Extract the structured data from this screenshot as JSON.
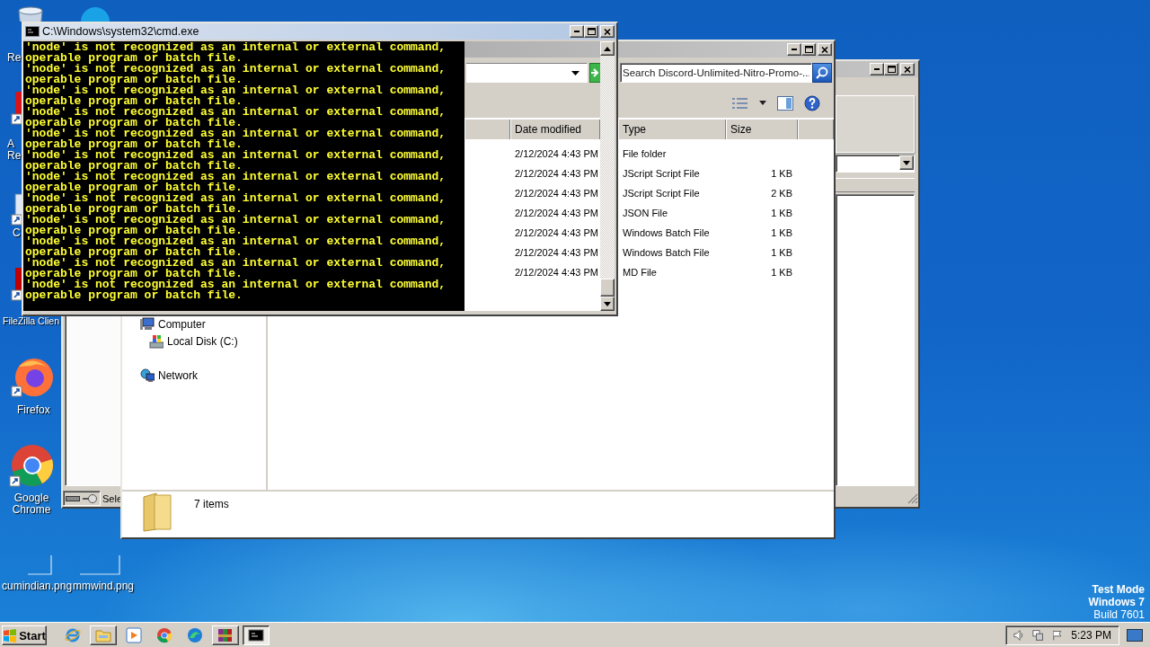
{
  "desktop": {
    "icons": [
      {
        "kind": "bin",
        "lines": [
          "Re"
        ]
      },
      {
        "kind": "blue_circle"
      },
      {
        "kind": "red_doc",
        "lines": [
          "A",
          "Re"
        ]
      },
      {
        "kind": "app",
        "lines": [
          "C"
        ]
      },
      {
        "kind": "red_app",
        "lines": [
          "FileZilla Clien"
        ]
      },
      {
        "kind": "fox_browser",
        "lines": [
          "Firefox"
        ]
      },
      {
        "kind": "round_browser",
        "lines": [
          "Google",
          "Chrome"
        ]
      },
      {
        "kind": "image",
        "lines": [
          "cumindian.png"
        ]
      },
      {
        "kind": "image",
        "lines": [
          "mmwind.png"
        ]
      }
    ],
    "system_info": [
      {
        "text": "Test Mode",
        "emphasis": true
      },
      {
        "text": "Windows 7",
        "emphasis": true
      },
      {
        "text": "Build 7601",
        "emphasis": false
      }
    ]
  },
  "background_window": {
    "status_text": "Sele"
  },
  "explorer_window": {
    "search": {
      "placeholder": "Search Discord-Unlimited-Nitro-Promo-..."
    },
    "nav": [
      {
        "kind": "computer",
        "label": "Computer",
        "children": [
          {
            "kind": "disk",
            "label": "Local Disk (C:)"
          }
        ]
      },
      {
        "kind": "network",
        "label": "Network"
      }
    ],
    "columns": [
      "Date modified",
      "Type",
      "Size"
    ],
    "rows": [
      {
        "date_modified": "2/12/2024 4:43 PM",
        "type": "File folder"
      },
      {
        "date_modified": "2/12/2024 4:43 PM",
        "type": "JScript Script File",
        "size": "1 KB"
      },
      {
        "date_modified": "2/12/2024 4:43 PM",
        "type": "JScript Script File",
        "size": "2 KB"
      },
      {
        "date_modified": "2/12/2024 4:43 PM",
        "type": "JSON File",
        "size": "1 KB"
      },
      {
        "date_modified": "2/12/2024 4:43 PM",
        "type": "Windows Batch File",
        "size": "1 KB"
      },
      {
        "date_modified": "2/12/2024 4:43 PM",
        "type": "Windows Batch File",
        "size": "1 KB"
      },
      {
        "date_modified": "2/12/2024 4:43 PM",
        "type": "MD File",
        "size": "1 KB"
      }
    ],
    "status": "7 items"
  },
  "console_window": {
    "title": "C:\\Windows\\system32\\cmd.exe",
    "lines": [
      "'node' is not recognized as an internal or external command,",
      "operable program or batch file.",
      "'node' is not recognized as an internal or external command,",
      "operable program or batch file.",
      "'node' is not recognized as an internal or external command,",
      "operable program or batch file.",
      "'node' is not recognized as an internal or external command,",
      "operable program or batch file.",
      "'node' is not recognized as an internal or external command,",
      "operable program or batch file.",
      "'node' is not recognized as an internal or external command,",
      "operable program or batch file.",
      "'node' is not recognized as an internal or external command,",
      "operable program or batch file.",
      "'node' is not recognized as an internal or external command,",
      "operable program or batch file.",
      "'node' is not recognized as an internal or external command,",
      "operable program or batch file.",
      "'node' is not recognized as an internal or external command,",
      "operable program or batch file.",
      "'node' is not recognized as an internal or external command,",
      "operable program or batch file.",
      "'node' is not recognized as an internal or external command,",
      "operable program or batch file."
    ]
  },
  "taskbar": {
    "start": "Start",
    "apps": [
      {
        "kind": "e_browser",
        "open": false,
        "selected": false
      },
      {
        "kind": "folder",
        "open": true,
        "selected": false
      },
      {
        "kind": "player",
        "open": false,
        "selected": false
      },
      {
        "kind": "round_browser",
        "open": false,
        "selected": false
      },
      {
        "kind": "swirl_browser",
        "open": false,
        "selected": false
      },
      {
        "kind": "archiver",
        "open": true,
        "selected": false
      },
      {
        "kind": "terminal",
        "open": true,
        "selected": true
      }
    ],
    "clock": "5:23 PM"
  }
}
